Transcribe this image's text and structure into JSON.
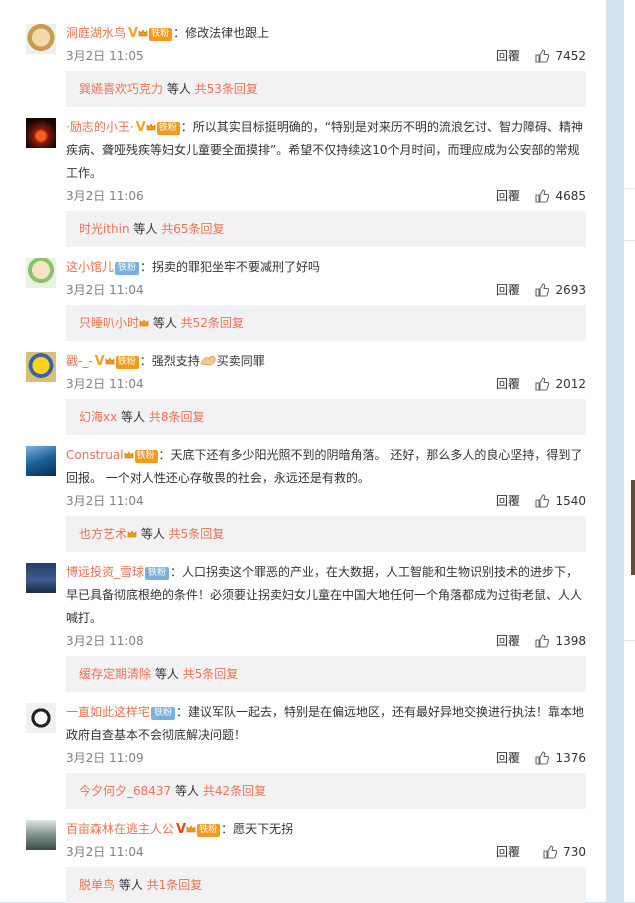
{
  "comments": [
    {
      "user": "洞庭湖水鸟",
      "user_v": true,
      "v_red": false,
      "user_vip": true,
      "vip_label": "铁粉",
      "user_fan": false,
      "text": "：修改法律也跟上",
      "time": "3月2日 11:05",
      "reply_label": "回覆",
      "likes": "7452",
      "replies_user": "巽嬿喜欢巧克力",
      "replies_has_crown": false,
      "replies_mid": " 等人 ",
      "replies_count": "共53条回复"
    },
    {
      "user": "·励志的小王·",
      "user_v": true,
      "v_red": false,
      "user_vip": true,
      "vip_label": "铁粉",
      "user_fan": false,
      "text": "：所以其实目标挺明确的，“特别是对来历不明的流浪乞讨、智力障碍、精神疾病、聋哑残疾等妇女儿童要全面摸排”。希望不仅持续这10个月时间，而理应成为公安部的常规工作。",
      "time": "3月2日 11:06",
      "reply_label": "回覆",
      "likes": "4685",
      "replies_user": "时光ithin",
      "replies_has_crown": false,
      "replies_mid": " 等人 ",
      "replies_count": "共65条回复"
    },
    {
      "user": "这小馆儿",
      "user_v": false,
      "v_red": false,
      "user_vip": false,
      "vip_label": "",
      "user_fan": true,
      "fan_label": "铁粉",
      "text": "：拐卖的罪犯坐牢不要减刑了好吗",
      "time": "3月2日 11:04",
      "reply_label": "回覆",
      "likes": "2693",
      "replies_user": "只睡叭小时",
      "replies_has_crown": true,
      "replies_mid": " 等人 ",
      "replies_count": "共52条回复"
    },
    {
      "user": "戳-_-",
      "user_v": true,
      "v_red": false,
      "user_vip": true,
      "vip_label": "铁粉",
      "user_fan": false,
      "text": "：强烈支持",
      "text_after": "买卖同罪",
      "time": "3月2日 11:04",
      "reply_label": "回覆",
      "likes": "2012",
      "replies_user": "幻海xx",
      "replies_has_crown": false,
      "replies_mid": " 等人 ",
      "replies_count": "共8条回复"
    },
    {
      "user": "Construal",
      "user_v": false,
      "v_red": false,
      "user_vip": true,
      "vip_label": "铁粉",
      "user_fan": false,
      "text": "：天底下还有多少阳光照不到的阴暗角落。 还好，那么多人的良心坚持，得到了回报。 一个对人性还心存敬畏的社会，永远还是有救的。",
      "time": "3月2日 11:04",
      "reply_label": "回覆",
      "likes": "1540",
      "replies_user": "也方艺术",
      "replies_has_crown": true,
      "replies_mid": " 等人 ",
      "replies_count": "共5条回复"
    },
    {
      "user": "博远投资_雪球",
      "user_v": false,
      "v_red": false,
      "user_vip": false,
      "vip_label": "",
      "user_fan": true,
      "fan_label": "铁粉",
      "text": "：人口拐卖这个罪恶的产业，在大数据，人工智能和生物识别技术的进步下，早已具备彻底根绝的条件！必须要让拐卖妇女儿童在中国大地任何一个角落都成为过街老鼠、人人喊打。",
      "time": "3月2日 11:08",
      "reply_label": "回覆",
      "likes": "1398",
      "replies_user": "缓存定期清除",
      "replies_has_crown": false,
      "replies_mid": " 等人 ",
      "replies_count": "共5条回复"
    },
    {
      "user": "一直如此这样宅",
      "user_v": false,
      "v_red": false,
      "user_vip": false,
      "vip_label": "",
      "user_fan": true,
      "fan_label": "铁粉",
      "text": "：建议军队一起去，特别是在偏远地区，还有最好异地交换进行执法！靠本地政府自查基本不会彻底解决问题！",
      "time": "3月2日 11:09",
      "reply_label": "回覆",
      "likes": "1376",
      "replies_user": "今夕何夕_68437",
      "replies_has_crown": false,
      "replies_mid": " 等人 ",
      "replies_count": "共42条回复"
    },
    {
      "user": "百亩森林在逃主人公",
      "user_v": true,
      "v_red": true,
      "user_vip": true,
      "vip_label": "铁粉",
      "user_fan": false,
      "text": "：愿天下无拐",
      "time": "3月2日 11:04",
      "reply_label": "回覆",
      "likes": "730",
      "replies_user": "脱单鸟",
      "replies_has_crown": false,
      "replies_mid": " 等人 ",
      "replies_count": "共1条回复"
    }
  ],
  "icons": {
    "like": "thumbs-up-icon",
    "verified": "v-verified-icon",
    "vip": "crown-vip-icon"
  },
  "colors": {
    "username": "#eb7350",
    "fan_badge": "#7ab0e0",
    "vip_badge": "#f39a1d",
    "reply_bar_bg": "#f2f2f5",
    "page_bg": "#d3e2f0"
  }
}
